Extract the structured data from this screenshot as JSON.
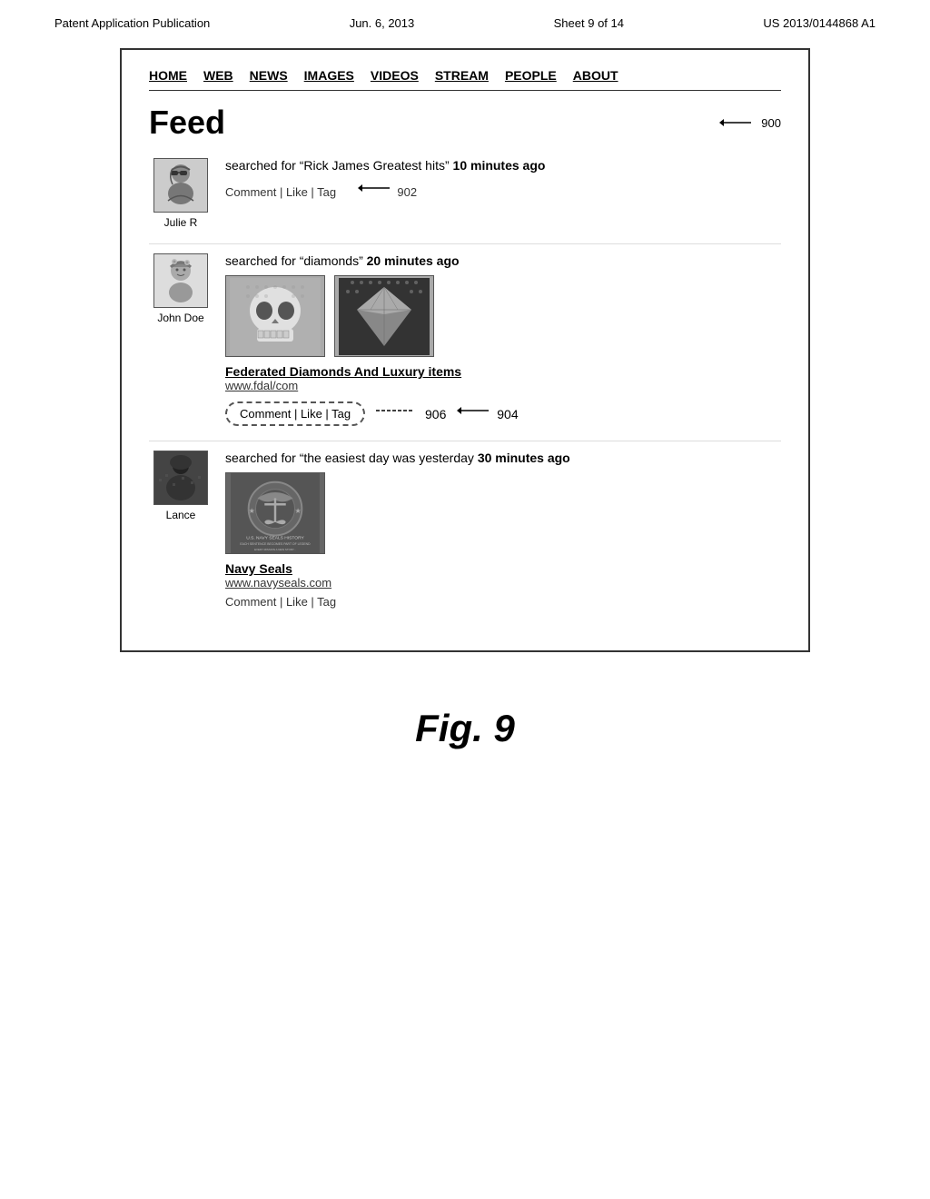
{
  "patent": {
    "header_left": "Patent Application Publication",
    "header_date": "Jun. 6, 2013",
    "header_sheet": "Sheet 9 of 14",
    "header_number": "US 2013/0144868 A1"
  },
  "nav": {
    "items": [
      "HOME",
      "WEB",
      "NEWS",
      "IMAGES",
      "VIDEOS",
      "STREAM",
      "PEOPLE",
      "ABOUT"
    ]
  },
  "feed": {
    "title": "Feed",
    "callout_900": "900",
    "callout_902": "902",
    "callout_904": "904",
    "callout_906": "906",
    "entries": [
      {
        "user": "Julie R",
        "search_prefix": "searched for “Rick James Greatest hits” ",
        "search_time": "10 minutes ago",
        "actions": "Comment | Like | Tag"
      },
      {
        "user": "John Doe",
        "search_prefix": "searched for “diamonds” ",
        "search_time": "20 minutes ago",
        "link_title": "Federated Diamonds And Luxury items",
        "link_url": "www.fdal/com",
        "actions": "Comment | Like | Tag"
      },
      {
        "user": "Lance",
        "search_prefix": "searched for “the easiest day was yesterday ",
        "search_time": "30 minutes ago",
        "link_title": "Navy Seals",
        "link_url": "www.navyseals.com",
        "actions": "Comment | Like | Tag"
      }
    ]
  },
  "figure": {
    "caption": "Fig. 9"
  }
}
